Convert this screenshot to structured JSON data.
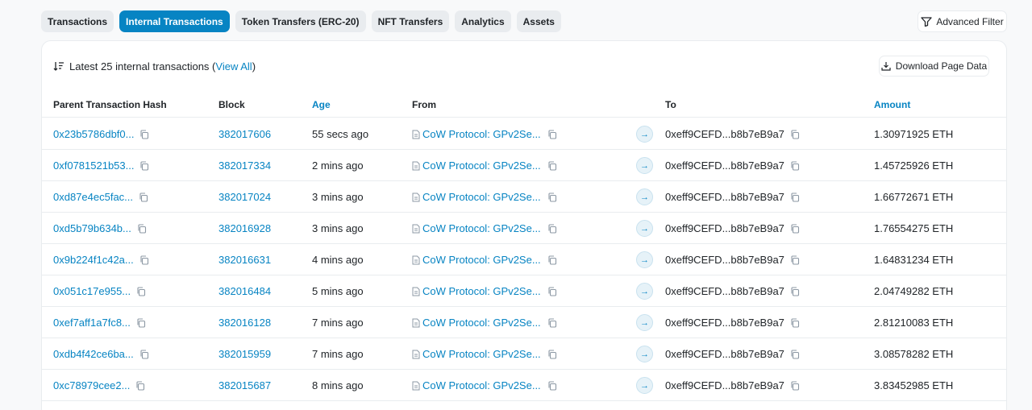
{
  "tabs": [
    {
      "label": "Transactions",
      "active": false
    },
    {
      "label": "Internal Transactions",
      "active": true
    },
    {
      "label": "Token Transfers (ERC-20)",
      "active": false
    },
    {
      "label": "NFT Transfers",
      "active": false
    },
    {
      "label": "Analytics",
      "active": false
    },
    {
      "label": "Assets",
      "active": false
    }
  ],
  "advanced_filter_label": "Advanced Filter",
  "card": {
    "summary_prefix": "Latest 25 internal transactions (",
    "view_all": "View All",
    "summary_suffix": ")",
    "download_label": "Download Page Data"
  },
  "table": {
    "headers": {
      "parent_hash": "Parent Transaction Hash",
      "block": "Block",
      "age": "Age",
      "from": "From",
      "to": "To",
      "amount": "Amount"
    },
    "rows": [
      {
        "hash": "0x23b5786dbf0...",
        "block": "382017606",
        "age": "55 secs ago",
        "from": "CoW Protocol: GPv2Se...",
        "to": "0xeff9CEFD...b8b7eB9a7",
        "amount": "1.30971925 ETH"
      },
      {
        "hash": "0xf0781521b53...",
        "block": "382017334",
        "age": "2 mins ago",
        "from": "CoW Protocol: GPv2Se...",
        "to": "0xeff9CEFD...b8b7eB9a7",
        "amount": "1.45725926 ETH"
      },
      {
        "hash": "0xd87e4ec5fac...",
        "block": "382017024",
        "age": "3 mins ago",
        "from": "CoW Protocol: GPv2Se...",
        "to": "0xeff9CEFD...b8b7eB9a7",
        "amount": "1.66772671 ETH"
      },
      {
        "hash": "0xd5b79b634b...",
        "block": "382016928",
        "age": "3 mins ago",
        "from": "CoW Protocol: GPv2Se...",
        "to": "0xeff9CEFD...b8b7eB9a7",
        "amount": "1.76554275 ETH"
      },
      {
        "hash": "0x9b224f1c42a...",
        "block": "382016631",
        "age": "4 mins ago",
        "from": "CoW Protocol: GPv2Se...",
        "to": "0xeff9CEFD...b8b7eB9a7",
        "amount": "1.64831234 ETH"
      },
      {
        "hash": "0x051c17e955...",
        "block": "382016484",
        "age": "5 mins ago",
        "from": "CoW Protocol: GPv2Se...",
        "to": "0xeff9CEFD...b8b7eB9a7",
        "amount": "2.04749282 ETH"
      },
      {
        "hash": "0xef7aff1a7fc8...",
        "block": "382016128",
        "age": "7 mins ago",
        "from": "CoW Protocol: GPv2Se...",
        "to": "0xeff9CEFD...b8b7eB9a7",
        "amount": "2.81210083 ETH"
      },
      {
        "hash": "0xdb4f42ce6ba...",
        "block": "382015959",
        "age": "7 mins ago",
        "from": "CoW Protocol: GPv2Se...",
        "to": "0xeff9CEFD...b8b7eB9a7",
        "amount": "3.08578282 ETH"
      },
      {
        "hash": "0xc78979cee2...",
        "block": "382015687",
        "age": "8 mins ago",
        "from": "CoW Protocol: GPv2Se...",
        "to": "0xeff9CEFD...b8b7eB9a7",
        "amount": "3.83452985 ETH"
      }
    ]
  },
  "icons": {
    "filter": "filter-icon",
    "sort": "sort-icon",
    "download": "download-icon",
    "copy": "copy-icon",
    "contract": "contract-file-icon",
    "arrow": "arrow-right-icon"
  },
  "colors": {
    "accent": "#0784c3",
    "tab_bg": "#e9ecef",
    "border": "#e9ecef"
  }
}
